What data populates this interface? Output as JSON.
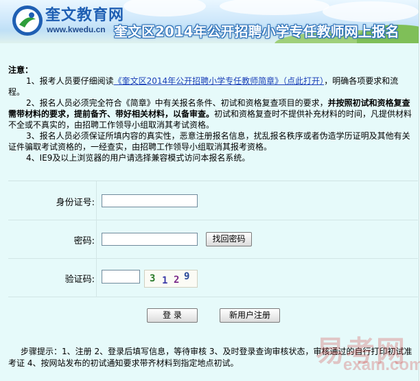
{
  "header": {
    "logo_text": "奎文教育网",
    "logo_url": "www.kwedu.cn",
    "title": "奎文区2014年公开招聘小学专任教师网上报名"
  },
  "notice": {
    "heading": "注意：",
    "item1_pre": "1、报考人员要仔细阅读",
    "item1_link": "《奎文区2014年公开招聘小学专任教师简章》（点此打开）",
    "item1_post": "，明确各项要求和流程。",
    "item2_pre": "2、报名人员必须完全符合《简章》中有关报名条件、初试和资格复查项目的要求，",
    "item2_bold": "并按照初试和资格复查需带材料的要求，提前备齐、带好相关材料，以备审查。",
    "item2_post": "初试和资格复查时不提供补充材料的时间，凡提供材料不全或不真实的，由招聘工作领导小组取消其考试资格。",
    "item3": "3、报名人员必须保证所填内容的真实性，恶意注册报名信息，扰乱报名秩序或者伪造学历证明及其他有关证件骗取考试资格的，一经查实，由招聘工作领导小组取消其报考资格。",
    "item4": "4、IE9及以上浏览器的用户请选择兼容模式访问本报名系统。"
  },
  "form": {
    "id_label": "身份证号:",
    "id_value": "",
    "password_label": "密码:",
    "password_value": "",
    "recover_button": "找回密码",
    "captcha_label": "验证码:",
    "captcha_value": "",
    "captcha_chars": [
      "3",
      "1",
      "2",
      "9"
    ],
    "login_button": "登 录",
    "register_button": "新用户注册"
  },
  "steps": {
    "text": "步骤提示：1、注册 2、登录后填写信息，等待审核 3、及时登录查询审核状态，审核通过的自行打印初试准考证 4、按网站发布的初试通知要求带齐材料到指定地点初试。"
  },
  "watermark": {
    "cn": "易考网",
    "en": "exam.com"
  }
}
